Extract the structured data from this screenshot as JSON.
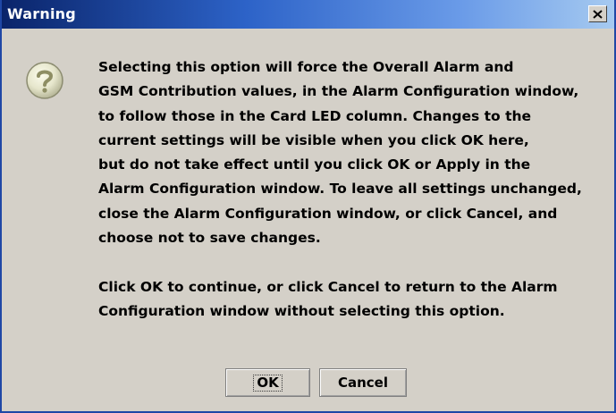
{
  "dialog": {
    "title": "Warning",
    "close_glyph": "×",
    "icon": "question-icon",
    "message_lines": [
      "Selecting this option will force the Overall Alarm and",
      "GSM Contribution values, in the Alarm Configuration window,",
      "to follow those in the Card LED column. Changes to the",
      "current settings will be visible when you click OK here,",
      "but do not take effect until you click OK or Apply in the",
      "Alarm Configuration window. To leave all settings unchanged,",
      "close the Alarm Configuration window, or click Cancel, and",
      "choose not to save changes."
    ],
    "message_lines_2": [
      "Click OK to continue, or click Cancel to return to the Alarm",
      "Configuration window without selecting this option."
    ],
    "buttons": {
      "ok": "OK",
      "cancel": "Cancel"
    }
  }
}
